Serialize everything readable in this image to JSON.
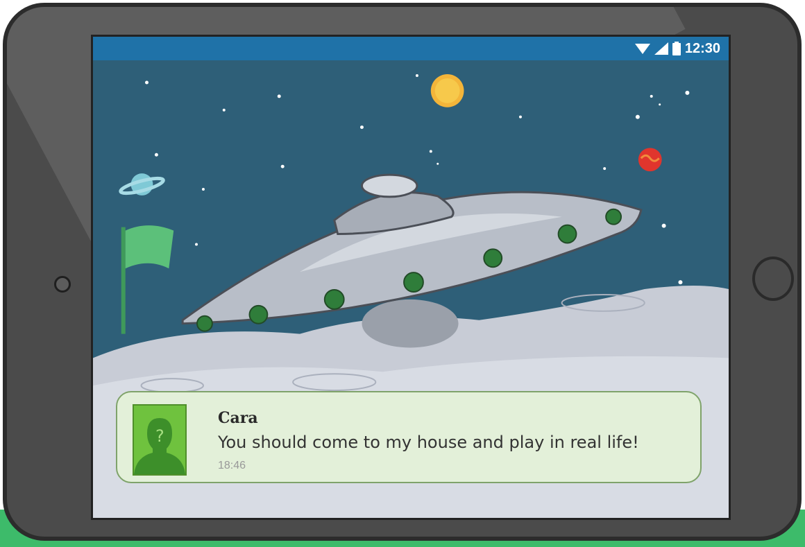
{
  "status_bar": {
    "time": "12:30",
    "icons": [
      "wifi-icon",
      "signal-icon",
      "battery-icon"
    ]
  },
  "scene": {
    "description_icons": [
      "planet-icon",
      "sun-icon",
      "red-planet-icon",
      "flag-icon",
      "ufo-illustration",
      "moon-surface"
    ]
  },
  "notification": {
    "sender": "Cara",
    "message": "You should come to my house and play in real life!",
    "time": "18:46",
    "avatar_icon": "unknown-person-avatar-icon"
  },
  "colors": {
    "status_bar": "#1f72a8",
    "sky": "#2e5f78",
    "notification_bg": "#e3f0d9",
    "avatar_bg": "#6fc23e",
    "device_frame": "#4b4b4b"
  }
}
